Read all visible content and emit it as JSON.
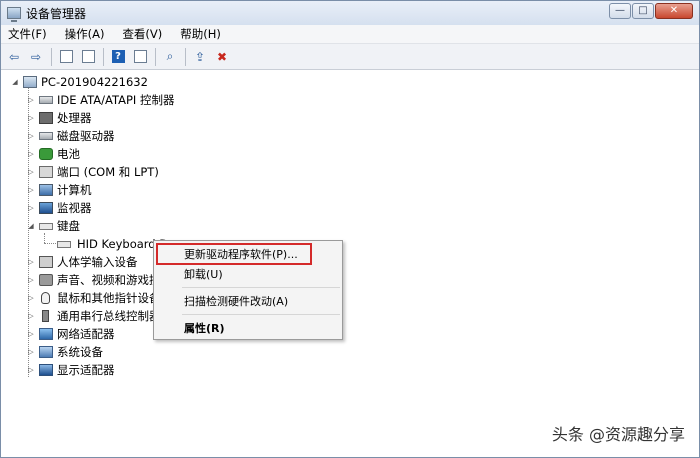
{
  "window": {
    "title": "设备管理器",
    "controls": {
      "minimize": "—",
      "maximize": "□",
      "close": "✕"
    }
  },
  "menubar": [
    "文件(F)",
    "操作(A)",
    "查看(V)",
    "帮助(H)"
  ],
  "toolbar": {
    "icons": [
      "back-arrow",
      "forward-arrow",
      "properties",
      "show-hide-tree",
      "help",
      "action-pane",
      "scan-hardware",
      "update-driver",
      "uninstall"
    ],
    "help_glyph": "?"
  },
  "tree": {
    "root": "PC-201904221632",
    "categories": [
      "IDE ATA/ATAPI 控制器",
      "处理器",
      "磁盘驱动器",
      "电池",
      "端口 (COM 和 LPT)",
      "计算机",
      "监视器",
      "键盘",
      "HID Keyboard D",
      "人体学输入设备",
      "声音、视频和游戏控",
      "鼠标和其他指针设备",
      "通用串行总线控制器",
      "网络适配器",
      "系统设备",
      "显示适配器"
    ]
  },
  "context_menu": {
    "items": [
      "更新驱动程序软件(P)...",
      "卸载(U)",
      "扫描检测硬件改动(A)",
      "属性(R)"
    ],
    "highlight_color": "#d42a2a"
  },
  "watermark": "头条 @资源趣分享"
}
